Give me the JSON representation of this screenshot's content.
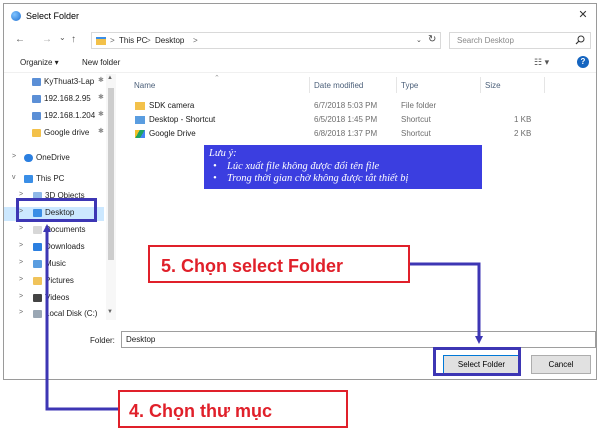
{
  "window": {
    "title": "Select Folder",
    "close": "✕"
  },
  "nav": {
    "back": "←",
    "forward": "→",
    "recent": "⌄",
    "up": "↑",
    "breadcrumbs": [
      "This PC",
      "Desktop"
    ],
    "separator": ">",
    "refresh": "↻",
    "dropdown": "⌄"
  },
  "search": {
    "placeholder": "Search Desktop",
    "icon": "search-icon"
  },
  "toolbar": {
    "organize": "Organize ▾",
    "new_folder": "New folder",
    "view": "☷ ▾",
    "help": "?"
  },
  "sidebar": {
    "items": [
      {
        "label": "KyThuat3-Lap",
        "pinned": true,
        "icon": "network-computer-icon"
      },
      {
        "label": "192.168.2.95",
        "pinned": true,
        "icon": "network-computer-icon"
      },
      {
        "label": "192.168.1.204",
        "pinned": true,
        "icon": "network-computer-icon"
      },
      {
        "label": "Google drive",
        "pinned": true,
        "icon": "folder-icon"
      },
      {
        "label": "OneDrive",
        "expander": ">",
        "icon": "cloud-icon"
      },
      {
        "label": "This PC",
        "expander": "v",
        "icon": "computer-icon"
      },
      {
        "label": "3D Objects",
        "expander": ">",
        "icon": "cube-icon"
      },
      {
        "label": "Desktop",
        "expander": ">",
        "icon": "desktop-icon",
        "selected": true
      },
      {
        "label": "Documents",
        "expander": ">",
        "icon": "documents-icon"
      },
      {
        "label": "Downloads",
        "expander": ">",
        "icon": "downloads-icon"
      },
      {
        "label": "Music",
        "expander": ">",
        "icon": "music-icon"
      },
      {
        "label": "Pictures",
        "expander": ">",
        "icon": "pictures-icon"
      },
      {
        "label": "Videos",
        "expander": ">",
        "icon": "videos-icon"
      },
      {
        "label": "Local Disk (C:)",
        "expander": ">",
        "icon": "disk-icon"
      }
    ]
  },
  "filelist": {
    "columns": [
      "Name",
      "Date modified",
      "Type",
      "Size"
    ],
    "rows": [
      {
        "name": "SDK camera",
        "date": "6/7/2018 5:03 PM",
        "type": "File folder",
        "size": "",
        "icon": "folder-icon"
      },
      {
        "name": "Desktop - Shortcut",
        "date": "6/5/2018 1:45 PM",
        "type": "Shortcut",
        "size": "1 KB",
        "icon": "shortcut-icon"
      },
      {
        "name": "Google Drive",
        "date": "6/8/2018 1:37 PM",
        "type": "Shortcut",
        "size": "2 KB",
        "icon": "google-drive-icon"
      }
    ]
  },
  "folder_field": {
    "label": "Folder:",
    "value": "Desktop"
  },
  "buttons": {
    "select": "Select Folder",
    "cancel": "Cancel"
  },
  "note": {
    "heading": "Lưu ý:",
    "bullet": "•",
    "lines": [
      "Lúc xuất file không được đổi tên file",
      "Trong thời gian chờ không được tắt thiết bị"
    ]
  },
  "callouts": {
    "step5": "5. Chọn select Folder",
    "step4": "4. Chọn thư mục"
  },
  "colors": {
    "note_bg": "#3b3ee0",
    "callout_red": "#e0202a",
    "arrow_blue": "#3d36b4",
    "folder_yellow": "#f3c14a"
  }
}
